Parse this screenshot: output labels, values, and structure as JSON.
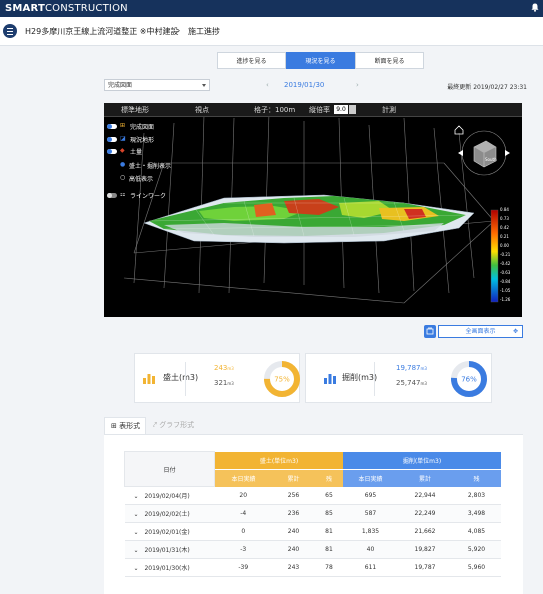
{
  "header": {
    "brand_bold": "SMART",
    "brand_light": "CONSTRUCTION"
  },
  "breadcrumb": {
    "project": "H29多摩川京王線上流河道整正 ※中村建設",
    "separator": "›",
    "page": "施工進捗"
  },
  "view_tabs": [
    {
      "label": "進捗を見る",
      "active": false
    },
    {
      "label": "現況を見る",
      "active": true
    },
    {
      "label": "断面を見る",
      "active": false
    }
  ],
  "controls": {
    "terrain_select": "完成図面",
    "date": "2019/01/30",
    "prev": "‹",
    "next": "›",
    "last_updated": "最終更新 2019/02/27 23:31"
  },
  "viewer": {
    "toolbar": {
      "standard_terrain": "標準地形",
      "viewpoint": "視点",
      "grid": "格子：100m",
      "vertical_ratio_label": "縦倍率",
      "vertical_ratio_value": "9.0",
      "measure": "計測"
    },
    "layers": [
      "完成図面",
      "現況地形",
      "土量",
      "盛土・掘削表示",
      "高低表示",
      "ラインワーク"
    ],
    "legend_values": [
      "0.84",
      "0.73",
      "0.42",
      "0.21",
      "0.00",
      "-0.21",
      "-0.42",
      "-0.63",
      "-0.84",
      "-1.05",
      "-1.26"
    ],
    "cube_label": "South"
  },
  "fullscreen": {
    "label": "全画面表示"
  },
  "cards": [
    {
      "label": "盛土(m3)",
      "today": "243",
      "total": "321",
      "unit": "m3",
      "percent": 75,
      "percent_label": "75%",
      "color": "#f2b433"
    },
    {
      "label": "掘削(m3)",
      "today": "19,787",
      "total": "25,747",
      "unit": "m3",
      "percent": 76,
      "percent_label": "76%",
      "color": "#3a7be0"
    }
  ],
  "panel_tabs": [
    {
      "label": "表形式",
      "icon": "table-icon",
      "active": true
    },
    {
      "label": "グラフ形式",
      "icon": "chart-icon",
      "active": false
    }
  ],
  "table": {
    "date_header": "日付",
    "fill_header": "盛土(単位m3)",
    "cut_header": "掘削(単位m3)",
    "sub_headers": [
      "本日実績",
      "累計",
      "残",
      "本日実績",
      "累計",
      "残"
    ],
    "rows": [
      [
        "2019/02/04(月)",
        "20",
        "256",
        "65",
        "695",
        "22,944",
        "2,803"
      ],
      [
        "2019/02/02(土)",
        "-4",
        "236",
        "85",
        "587",
        "22,249",
        "3,498"
      ],
      [
        "2019/02/01(金)",
        "0",
        "240",
        "81",
        "1,835",
        "21,662",
        "4,085"
      ],
      [
        "2019/01/31(木)",
        "-3",
        "240",
        "81",
        "40",
        "19,827",
        "5,920"
      ],
      [
        "2019/01/30(水)",
        "-39",
        "243",
        "78",
        "611",
        "19,787",
        "5,960"
      ]
    ]
  }
}
